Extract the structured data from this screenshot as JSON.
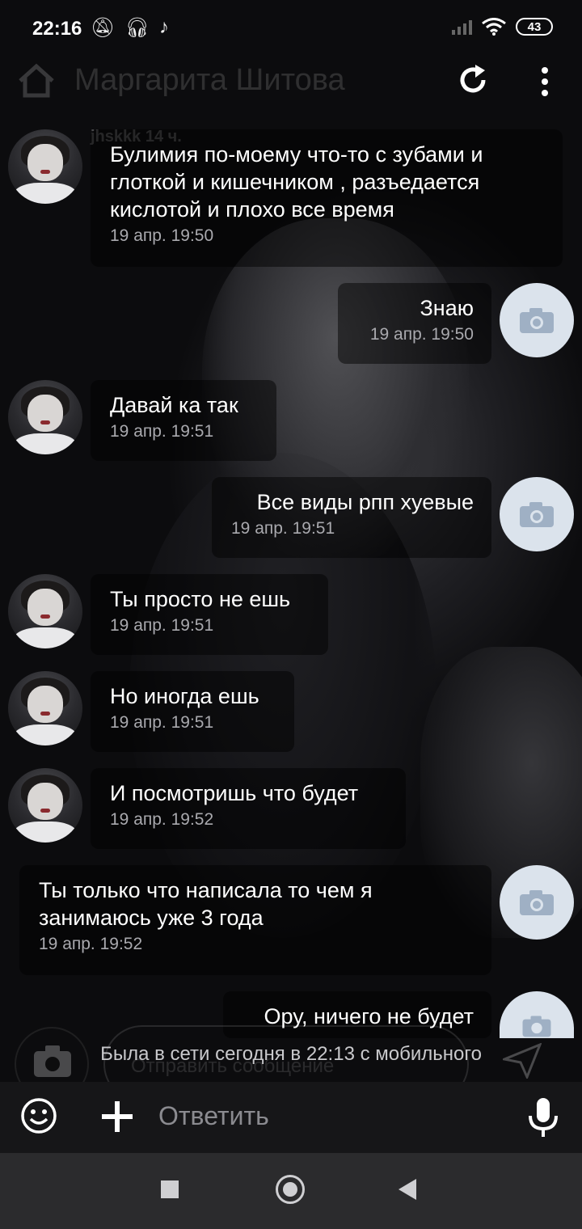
{
  "status_bar": {
    "time": "22:16",
    "battery": "43"
  },
  "header": {
    "title": "Маргарита Шитова"
  },
  "sender_fragment": "jhskkk 14 ч.",
  "messages": [
    {
      "side": "left",
      "lines": [
        "Булимия по-моему что-то с зубами и",
        "глоткой и кишечником , разъедается",
        "кислотой и плохо все время"
      ],
      "time": "19 апр. 19:50"
    },
    {
      "side": "right",
      "lines": [
        "Знаю"
      ],
      "time": "19 апр. 19:50"
    },
    {
      "side": "left",
      "lines": [
        "Давай ка так"
      ],
      "time": "19 апр. 19:51"
    },
    {
      "side": "right",
      "lines": [
        "Все виды рпп хуевые"
      ],
      "time": "19 апр. 19:51"
    },
    {
      "side": "left",
      "lines": [
        "Ты просто не ешь"
      ],
      "time": "19 апр. 19:51"
    },
    {
      "side": "left",
      "lines": [
        "Но иногда ешь"
      ],
      "time": "19 апр. 19:51"
    },
    {
      "side": "left",
      "lines": [
        "И посмотришь что будет"
      ],
      "time": "19 апр. 19:52"
    },
    {
      "side": "right",
      "lines": [
        "Ты только что написала то чем я",
        "занимаюсь уже 3 года"
      ],
      "time": "19 апр. 19:52"
    },
    {
      "side": "right",
      "lines": [
        "Ору, ничего не будет"
      ],
      "time": ""
    }
  ],
  "last_seen": "Была в сети сегодня в 22:13 с мобильного",
  "ghost_placeholder": "Отправить сообщение",
  "compose": {
    "placeholder": "Ответить"
  }
}
